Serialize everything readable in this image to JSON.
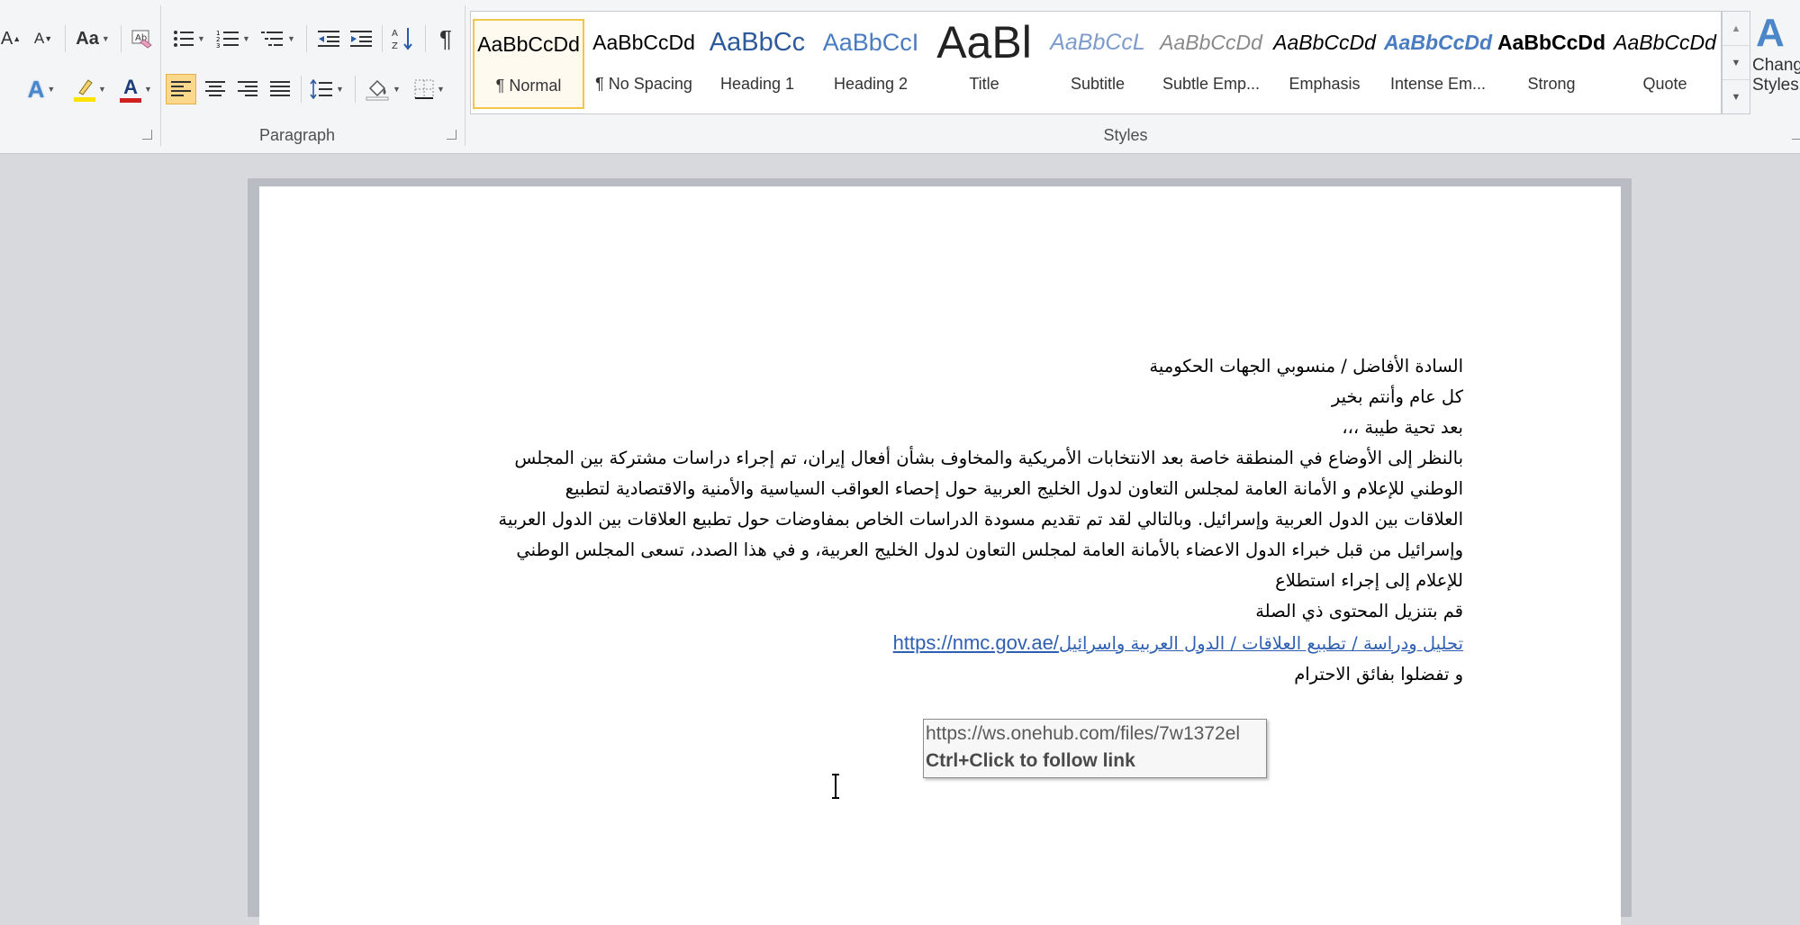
{
  "ribbon": {
    "font_buttons": {
      "grow": "A",
      "shrink": "A",
      "change_case": "Aa",
      "font_color": "A"
    },
    "groups": {
      "paragraph": "Paragraph",
      "styles": "Styles"
    },
    "pilcrow": "¶",
    "styles_gallery": [
      {
        "sample": "AaBbCcDd",
        "name": "¶ Normal"
      },
      {
        "sample": "AaBbCcDd",
        "name": "¶ No Spacing"
      },
      {
        "sample": "AaBbCc",
        "name": "Heading 1"
      },
      {
        "sample": "AaBbCcI",
        "name": "Heading 2"
      },
      {
        "sample": "AaBl",
        "name": "Title"
      },
      {
        "sample": "AaBbCcL",
        "name": "Subtitle"
      },
      {
        "sample": "AaBbCcDd",
        "name": "Subtle Emp..."
      },
      {
        "sample": "AaBbCcDd",
        "name": "Emphasis"
      },
      {
        "sample": "AaBbCcDd",
        "name": "Intense Em..."
      },
      {
        "sample": "AaBbCcDd",
        "name": "Strong"
      },
      {
        "sample": "AaBbCcDd",
        "name": "Quote"
      }
    ],
    "change_styles": {
      "line1": "Change",
      "line2": "Styles"
    }
  },
  "document": {
    "lines": [
      "السادة الأفاضل / منسوبي الجهات الحكومية",
      "كل عام وأنتم بخير",
      "بعد تحية طيبة ،،،",
      "بالنظر إلى الأوضاع في المنطقة خاصة بعد الانتخابات الأمريكية والمخاوف بشأن أفعال إيران، تم إجراء دراسات مشتركة بين المجلس",
      "الوطني للإعلام و الأمانة العامة لمجلس التعاون لدول الخليج العربية حول إحصاء العواقب السياسية والأمنية والاقتصادية لتطبيع",
      "العلاقات بين الدول العربية وإسرائيل. وبالتالي لقد تم تقديم مسودة الدراسات الخاص بمفاوضات حول تطبيع العلاقات بين الدول العربية",
      "وإسرائيل من قبل خبراء الدول الاعضاء بالأمانة العامة لمجلس التعاون لدول الخليج العربية، و في هذا الصدد، تسعى المجلس الوطني",
      "للإعلام إلى إجراء استطلاع",
      "قم بتنزيل المحتوى ذي الصلة"
    ],
    "link_text_arabic": "تحليل ودراسة / تطبيع العلاقات / الدول العربية واسرائيل",
    "link_url_text": "https://nmc.gov.ae/",
    "closing": "و تفضلوا بفائق الاحترام"
  },
  "tooltip": {
    "url": "https://ws.onehub.com/files/7w1372el",
    "hint": "Ctrl+Click to follow link"
  },
  "colors": {
    "link": "#2f5fb2",
    "selected_style_border": "#f2c649",
    "font_color_bar": "#d02020",
    "highlight_bar": "#ffe200"
  }
}
